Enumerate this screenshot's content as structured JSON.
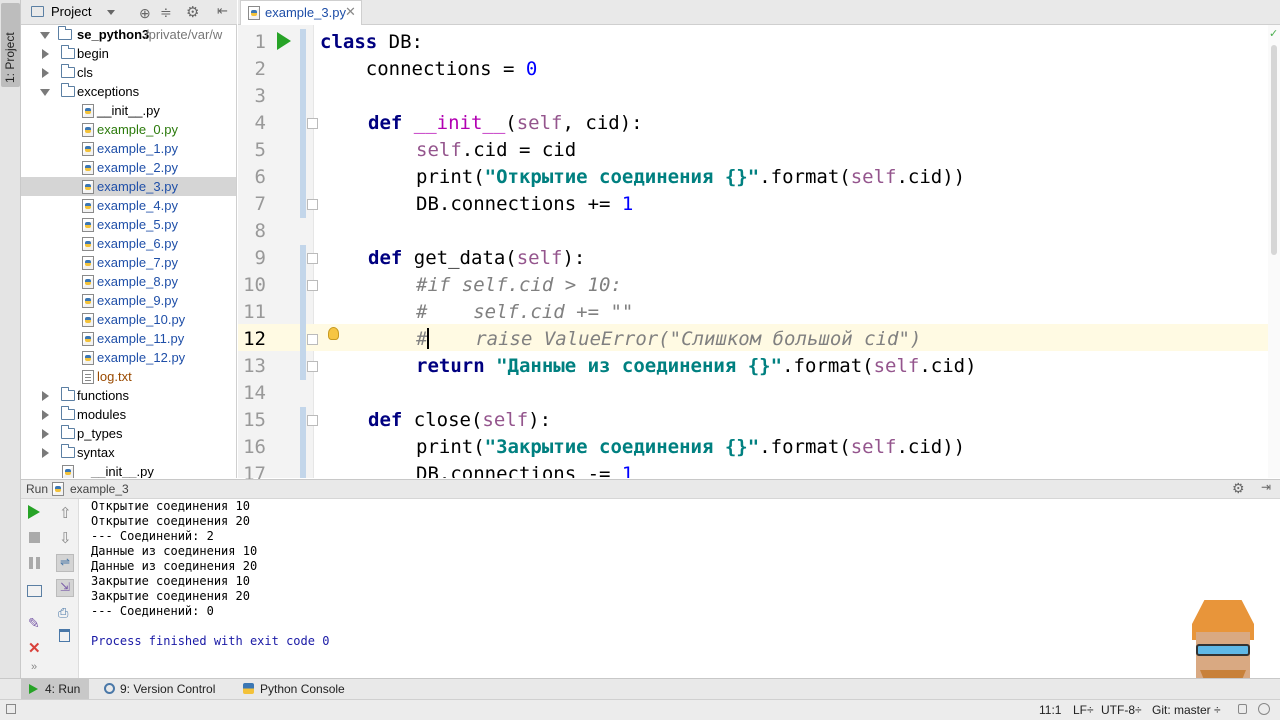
{
  "left_stripe": {
    "project_label": "1: Project"
  },
  "project_panel": {
    "title": "Project",
    "root": {
      "name": "se_python3",
      "path": "/private/var/w"
    },
    "items": [
      {
        "label": "begin",
        "type": "folder",
        "state": "collapsed"
      },
      {
        "label": "cls",
        "type": "folder",
        "state": "collapsed"
      },
      {
        "label": "exceptions",
        "type": "folder",
        "state": "expanded"
      },
      {
        "label": "__init__.py",
        "type": "py"
      },
      {
        "label": "example_0.py",
        "type": "py"
      },
      {
        "label": "example_1.py",
        "type": "py"
      },
      {
        "label": "example_2.py",
        "type": "py"
      },
      {
        "label": "example_3.py",
        "type": "py",
        "selected": true
      },
      {
        "label": "example_4.py",
        "type": "py"
      },
      {
        "label": "example_5.py",
        "type": "py"
      },
      {
        "label": "example_6.py",
        "type": "py"
      },
      {
        "label": "example_7.py",
        "type": "py"
      },
      {
        "label": "example_8.py",
        "type": "py"
      },
      {
        "label": "example_9.py",
        "type": "py"
      },
      {
        "label": "example_10.py",
        "type": "py"
      },
      {
        "label": "example_11.py",
        "type": "py"
      },
      {
        "label": "example_12.py",
        "type": "py"
      },
      {
        "label": "log.txt",
        "type": "txt"
      },
      {
        "label": "functions",
        "type": "folder",
        "state": "collapsed"
      },
      {
        "label": "modules",
        "type": "folder",
        "state": "collapsed"
      },
      {
        "label": "p_types",
        "type": "folder",
        "state": "collapsed"
      },
      {
        "label": "syntax",
        "type": "folder",
        "state": "collapsed"
      },
      {
        "label": "__init__.py",
        "type": "py"
      }
    ],
    "colors": {
      "added_file": "#2b7a0b",
      "modified_file": "#1f4fa8",
      "untracked_file": "#9a4a00"
    }
  },
  "editor": {
    "tab_label": "example_3.py",
    "current_line": 12,
    "lines": [
      {
        "n": "1"
      },
      {
        "n": "2"
      },
      {
        "n": "3"
      },
      {
        "n": "4"
      },
      {
        "n": "5"
      },
      {
        "n": "6"
      },
      {
        "n": "7"
      },
      {
        "n": "8"
      },
      {
        "n": "9"
      },
      {
        "n": "10"
      },
      {
        "n": "11"
      },
      {
        "n": "12"
      },
      {
        "n": "13"
      },
      {
        "n": "14"
      },
      {
        "n": "15"
      },
      {
        "n": "16"
      },
      {
        "n": "17"
      }
    ],
    "code": {
      "l1_kw": "class",
      "l1_rest": " DB:",
      "l2_a": "    connections = ",
      "l2_num": "0",
      "l4_kw": "def",
      "l4_name": " __init__",
      "l4_p1": "(",
      "l4_self": "self",
      "l4_p2": ", cid):",
      "l5_self": "self",
      "l5_rest": ".cid = cid",
      "l6_a": "print(",
      "l6_str": "\"Открытие соединения {}\"",
      "l6_b": ".format(",
      "l6_self": "self",
      "l6_c": ".cid))",
      "l7_a": "DB.connections += ",
      "l7_num": "1",
      "l9_kw": "def",
      "l9_a": " get_data(",
      "l9_self": "self",
      "l9_b": "):",
      "l10": "#if self.cid > 10:",
      "l11": "#    self.cid += \"\"",
      "l12_hash": "#",
      "l12_rest": "    raise ValueError(\"Слишком большой cid\")",
      "l13_kw": "return",
      "l13_str": " \"Данные из соединения {}\"",
      "l13_b": ".format(",
      "l13_self": "self",
      "l13_c": ".cid)",
      "l15_kw": "def",
      "l15_a": " close(",
      "l15_self": "self",
      "l15_b": "):",
      "l16_a": "print(",
      "l16_str": "\"Закрытие соединения {}\"",
      "l16_b": ".format(",
      "l16_self": "self",
      "l16_c": ".cid))",
      "l17_a": "DB.connections -= ",
      "l17_num": "1"
    }
  },
  "run_panel": {
    "label": "Run",
    "config": "example_3",
    "output": [
      "Открытие соединения 10",
      "Открытие соединения 20",
      "--- Соединений: 2",
      "Данные из соединения 10",
      "Данные из соединения 20",
      "Закрытие соединения 10",
      "Закрытие соединения 20",
      "--- Соединений: 0",
      "",
      "Process finished with exit code 0"
    ]
  },
  "bottom_tabs": {
    "run": "4: Run",
    "vcs": "9: Version Control",
    "console": "Python Console"
  },
  "status": {
    "position": "11:1",
    "line_sep": "LF÷",
    "encoding": "UTF-8÷",
    "git": "Git: master ÷"
  }
}
